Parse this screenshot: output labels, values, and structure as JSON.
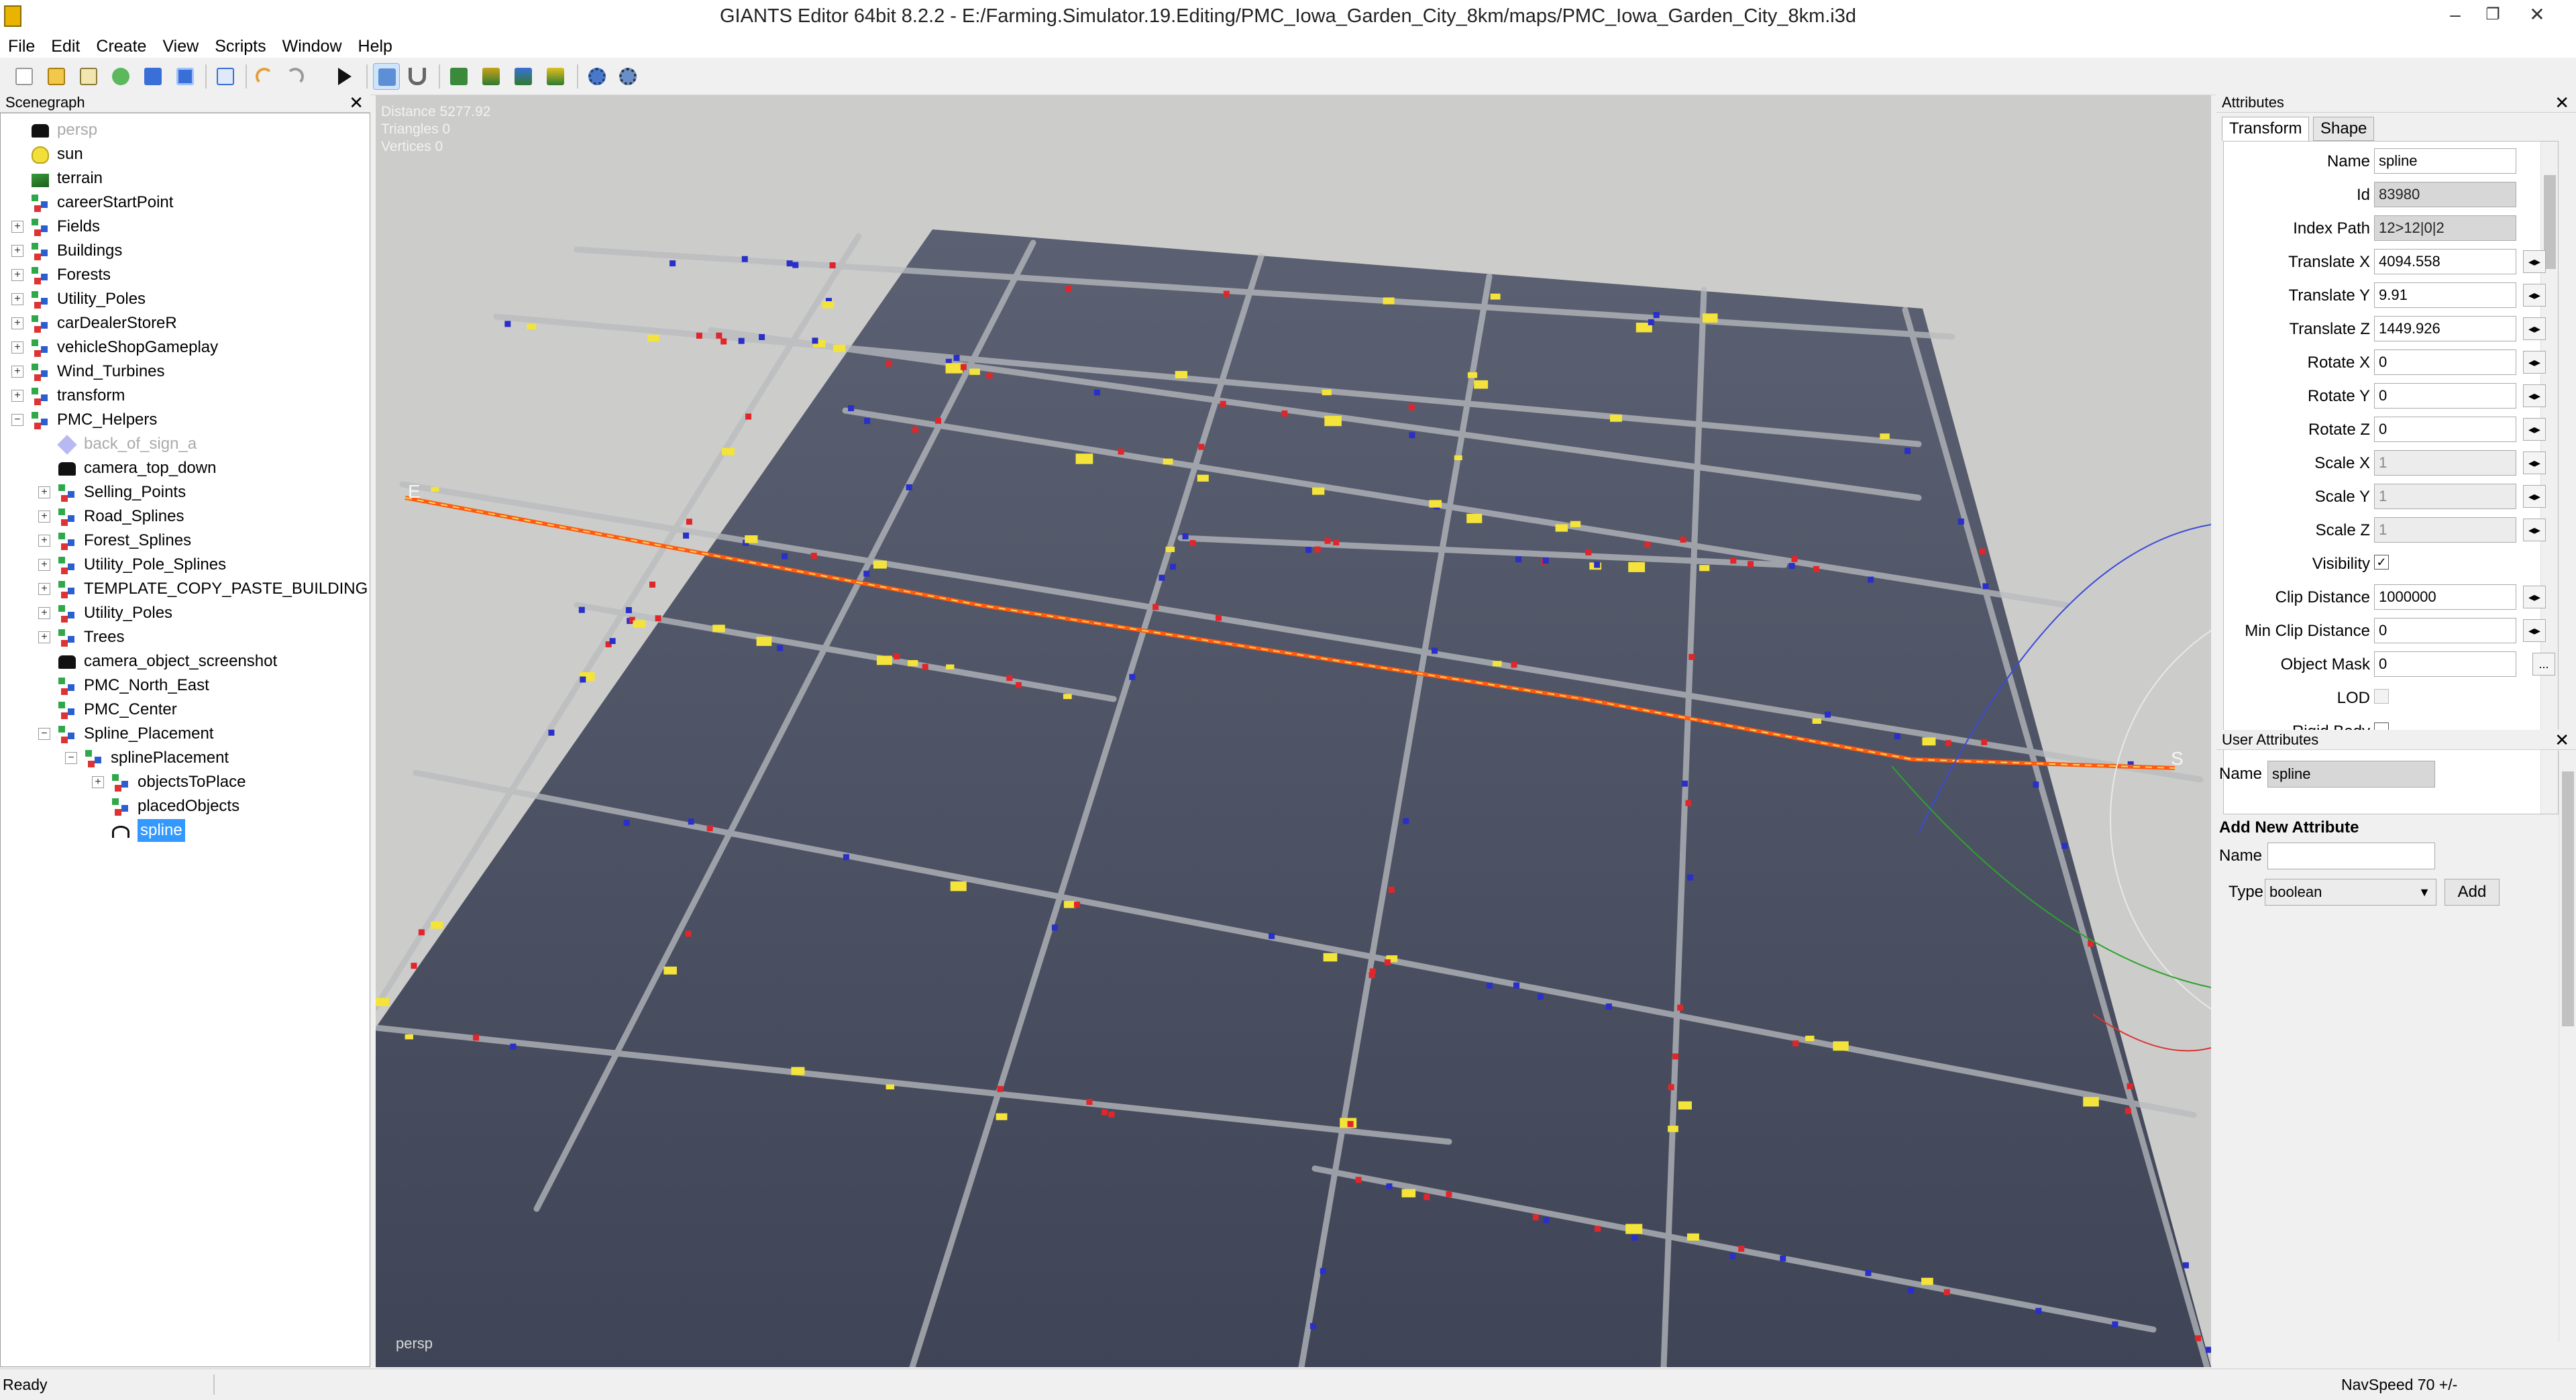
{
  "window": {
    "title": "GIANTS Editor 64bit 8.2.2 - E:/Farming.Simulator.19.Editing/PMC_Iowa_Garden_City_8km/maps/PMC_Iowa_Garden_City_8km.i3d",
    "minimize": "–",
    "maximize": "❐",
    "close": "✕"
  },
  "menu": [
    "File",
    "Edit",
    "Create",
    "View",
    "Scripts",
    "Window",
    "Help"
  ],
  "toolbar": {
    "icons": [
      "new-file-icon",
      "open-folder-icon",
      "edit-file-icon",
      "refresh-icon",
      "save-icon",
      "save-as-icon",
      "import-icon",
      "undo-icon",
      "redo-icon",
      "play-icon",
      "select-move-icon",
      "magnet-icon",
      "terrain-paint-icon",
      "terrain-sculpt-icon",
      "foliage-paint-icon",
      "texture-paint-icon",
      "settings-gear-icon",
      "plugin-gear-icon"
    ]
  },
  "scenegraph": {
    "title": "Scenegraph",
    "close": "✕",
    "nodes": [
      {
        "label": "persp",
        "icon": "camera-icon",
        "depth": 1,
        "dim": true
      },
      {
        "label": "sun",
        "icon": "light-bulb-icon",
        "depth": 1
      },
      {
        "label": "terrain",
        "icon": "terrain-icon",
        "depth": 1
      },
      {
        "label": "careerStartPoint",
        "icon": "transform-group-icon",
        "depth": 1
      },
      {
        "label": "Fields",
        "icon": "transform-group-icon",
        "depth": 1,
        "exp": "+"
      },
      {
        "label": "Buildings",
        "icon": "transform-group-icon",
        "depth": 1,
        "exp": "+"
      },
      {
        "label": "Forests",
        "icon": "transform-group-icon",
        "depth": 1,
        "exp": "+"
      },
      {
        "label": "Utility_Poles",
        "icon": "transform-group-icon",
        "depth": 1,
        "exp": "+"
      },
      {
        "label": "carDealerStoreR",
        "icon": "transform-group-icon",
        "depth": 1,
        "exp": "+"
      },
      {
        "label": "vehicleShopGameplay",
        "icon": "transform-group-icon",
        "depth": 1,
        "exp": "+"
      },
      {
        "label": "Wind_Turbines",
        "icon": "transform-group-icon",
        "depth": 1,
        "exp": "+"
      },
      {
        "label": "transform",
        "icon": "transform-group-icon",
        "depth": 1,
        "exp": "+"
      },
      {
        "label": "PMC_Helpers",
        "icon": "transform-group-icon",
        "depth": 1,
        "exp": "−"
      },
      {
        "label": "back_of_sign_a",
        "icon": "shape-cube-icon",
        "depth": 2,
        "dim": true
      },
      {
        "label": "camera_top_down",
        "icon": "camera-icon",
        "depth": 2
      },
      {
        "label": "Selling_Points",
        "icon": "transform-group-icon",
        "depth": 2,
        "exp": "+"
      },
      {
        "label": "Road_Splines",
        "icon": "transform-group-icon",
        "depth": 2,
        "exp": "+"
      },
      {
        "label": "Forest_Splines",
        "icon": "transform-group-icon",
        "depth": 2,
        "exp": "+"
      },
      {
        "label": "Utility_Pole_Splines",
        "icon": "transform-group-icon",
        "depth": 2,
        "exp": "+"
      },
      {
        "label": "TEMPLATE_COPY_PASTE_BUILDING",
        "icon": "transform-group-icon",
        "depth": 2,
        "exp": "+"
      },
      {
        "label": "Utility_Poles",
        "icon": "transform-group-icon",
        "depth": 2,
        "exp": "+"
      },
      {
        "label": "Trees",
        "icon": "transform-group-icon",
        "depth": 2,
        "exp": "+"
      },
      {
        "label": "camera_object_screenshot",
        "icon": "camera-icon",
        "depth": 2
      },
      {
        "label": "PMC_North_East",
        "icon": "transform-group-icon",
        "depth": 2
      },
      {
        "label": "PMC_Center",
        "icon": "transform-group-icon",
        "depth": 2
      },
      {
        "label": "Spline_Placement",
        "icon": "transform-group-icon",
        "depth": 2,
        "exp": "−"
      },
      {
        "label": "splinePlacement",
        "icon": "transform-group-icon",
        "depth": 3,
        "exp": "−"
      },
      {
        "label": "objectsToPlace",
        "icon": "transform-group-icon",
        "depth": 4,
        "exp": "+"
      },
      {
        "label": "placedObjects",
        "icon": "transform-group-icon",
        "depth": 4
      },
      {
        "label": "spline",
        "icon": "spline-icon",
        "depth": 4,
        "selected": true
      }
    ]
  },
  "viewport": {
    "stats": {
      "distance": "Distance 5277.92",
      "triangles": "Triangles 0",
      "vertices": "Vertices 0"
    },
    "camera": "persp",
    "spline_start": "E",
    "spline_end": "S"
  },
  "attributes": {
    "title": "Attributes",
    "close": "✕",
    "tabs": [
      "Transform",
      "Shape"
    ],
    "rows": [
      {
        "label": "Name",
        "value": "spline",
        "kind": "text"
      },
      {
        "label": "Id",
        "value": "83980",
        "kind": "ro"
      },
      {
        "label": "Index Path",
        "value": "12>12|0|2",
        "kind": "ro"
      },
      {
        "label": "Translate X",
        "value": "4094.558",
        "kind": "spin"
      },
      {
        "label": "Translate Y",
        "value": "9.91",
        "kind": "spin"
      },
      {
        "label": "Translate Z",
        "value": "1449.926",
        "kind": "spin"
      },
      {
        "label": "Rotate X",
        "value": "0",
        "kind": "spin"
      },
      {
        "label": "Rotate Y",
        "value": "0",
        "kind": "spin"
      },
      {
        "label": "Rotate Z",
        "value": "0",
        "kind": "spin"
      },
      {
        "label": "Scale X",
        "value": "1",
        "kind": "spin-dis"
      },
      {
        "label": "Scale Y",
        "value": "1",
        "kind": "spin-dis"
      },
      {
        "label": "Scale Z",
        "value": "1",
        "kind": "spin-dis"
      },
      {
        "label": "Visibility",
        "value": "✓",
        "kind": "check"
      },
      {
        "label": "Clip Distance",
        "value": "1000000",
        "kind": "spin"
      },
      {
        "label": "Min Clip Distance",
        "value": "0",
        "kind": "spin"
      },
      {
        "label": "Object Mask",
        "value": "0",
        "kind": "more"
      },
      {
        "label": "LOD",
        "value": "",
        "kind": "check-dis"
      },
      {
        "label": "Rigid Body",
        "value": "",
        "kind": "check"
      }
    ],
    "more_button": "...",
    "spin_glyph": "◂▸"
  },
  "user_attributes": {
    "title": "User Attributes",
    "close": "✕",
    "name_label": "Name",
    "name_value": "spline",
    "add_heading": "Add New Attribute",
    "new_name_label": "Name",
    "new_name_value": "",
    "type_label": "Type",
    "type_value": "boolean",
    "add_button": "Add"
  },
  "status": {
    "left": "Ready",
    "right": "NavSpeed 70 +/-"
  }
}
